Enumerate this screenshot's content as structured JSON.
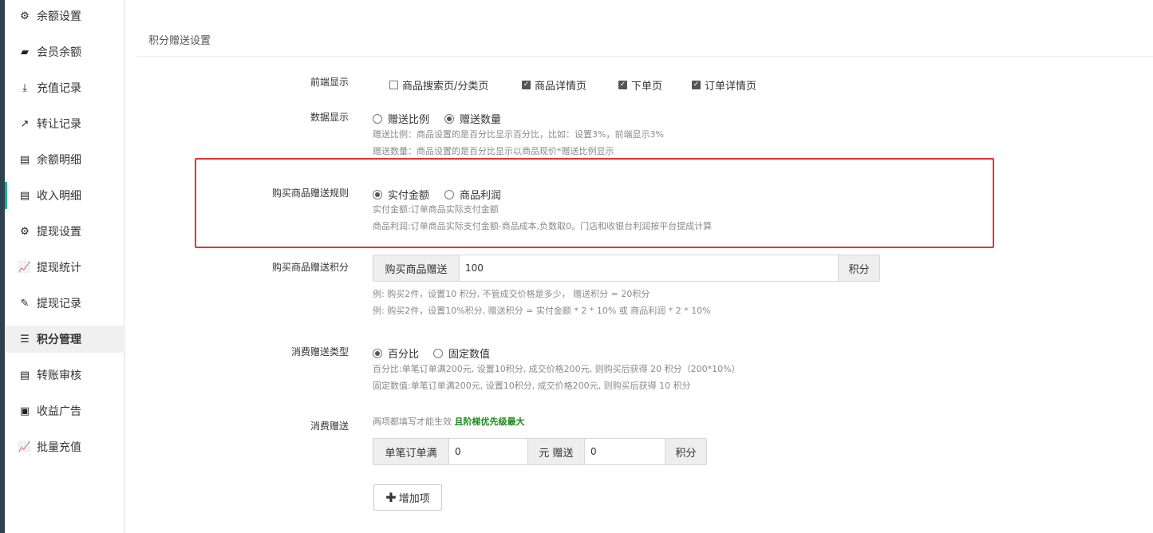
{
  "sidebar": {
    "items": [
      {
        "label": "余额设置",
        "icon": "gear-icon"
      },
      {
        "label": "会员余额",
        "icon": "book-icon"
      },
      {
        "label": "充值记录",
        "icon": "download-icon"
      },
      {
        "label": "转让记录",
        "icon": "external-link-icon"
      },
      {
        "label": "余额明细",
        "icon": "document-icon"
      },
      {
        "label": "收入明细",
        "icon": "document-icon"
      },
      {
        "label": "提现设置",
        "icon": "gear-icon"
      },
      {
        "label": "提现统计",
        "icon": "line-chart-icon"
      },
      {
        "label": "提现记录",
        "icon": "pencil-icon"
      },
      {
        "label": "积分管理",
        "icon": "database-icon"
      },
      {
        "label": "转账审核",
        "icon": "document-icon"
      },
      {
        "label": "收益广告",
        "icon": "image-icon"
      },
      {
        "label": "批量充值",
        "icon": "line-chart-icon"
      }
    ],
    "active_label": "积分管理",
    "accent_color": "#1ab394"
  },
  "main": {
    "title": "积分赠送设置",
    "frontend_display": {
      "label": "前端显示",
      "options": [
        {
          "label": "商品搜索页/分类页",
          "checked": false
        },
        {
          "label": "商品详情页",
          "checked": true
        },
        {
          "label": "下单页",
          "checked": true
        },
        {
          "label": "订单详情页",
          "checked": true
        }
      ]
    },
    "data_display": {
      "label": "数据显示",
      "options": [
        {
          "label": "赠送比例",
          "selected": false
        },
        {
          "label": "赠送数量",
          "selected": true
        }
      ],
      "help1": "赠送比例：商品设置的是百分比显示百分比，比如：设置3%，前端显示3%",
      "help2": "赠送数量：商品设置的是百分比显示以商品现价*赠送比例显示"
    },
    "purchase_rule": {
      "label": "购买商品赠送规则",
      "options": [
        {
          "label": "实付金额",
          "selected": true
        },
        {
          "label": "商品利润",
          "selected": false
        }
      ],
      "help1": "实付金额:订单商品实际支付金额",
      "help2": "商品利润:订单商品实际支付金额-商品成本,负数取0。门店和收银台利润按平台提成计算",
      "highlight_color": "#e53333"
    },
    "purchase_points": {
      "label": "购买商品赠送积分",
      "prefix": "购买商品赠送",
      "value": "100",
      "suffix": "积分",
      "help1": "例: 购买2件，设置10 积分, 不管成交价格是多少， 赠送积分 = 20积分",
      "help2": "例: 购买2件，设置10%积分, 赠送积分 = 实付金额 * 2 * 10% 或 商品利润 * 2 * 10%"
    },
    "consume_type": {
      "label": "消费赠送类型",
      "options": [
        {
          "label": "百分比",
          "selected": true
        },
        {
          "label": "固定数值",
          "selected": false
        }
      ],
      "help1": "百分比:单笔订单满200元, 设置10积分, 成交价格200元, 则购买后获得 20 积分（200*10%）",
      "help2": "固定数值:单笔订单满200元, 设置10积分, 成交价格200元, 则购买后获得 10 积分"
    },
    "consume_gift": {
      "label": "消费赠送",
      "note": "两项都填写才能生效",
      "note_strong": "且阶梯优先级最大",
      "prefix": "单笔订单满",
      "amount_value": "0",
      "middle": "元 赠送",
      "points_value": "0",
      "suffix": "积分",
      "add_button": "增加项"
    }
  }
}
